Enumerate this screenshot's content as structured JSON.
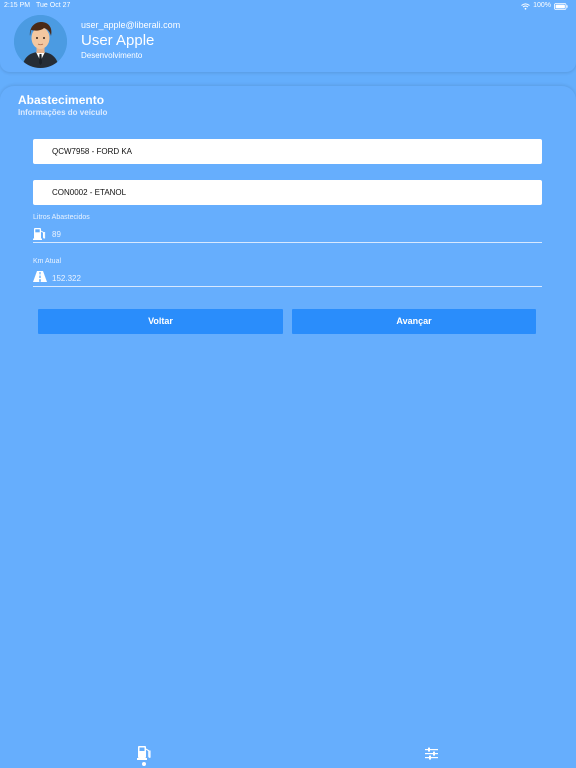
{
  "status_bar": {
    "time": "2:15 PM",
    "date": "Tue Oct 27",
    "battery": "100%"
  },
  "user": {
    "email": "user_apple@liberali.com",
    "name": "User Apple",
    "department": "Desenvolvimento"
  },
  "page": {
    "title": "Abastecimento",
    "subtitle": "Informações do veículo"
  },
  "form": {
    "vehicle": "QCW7958 - FORD KA",
    "fuel": "CON0002 - ETANOL",
    "liters_label": "Litros Abastecidos",
    "liters_value": "89",
    "km_label": "Km Atual",
    "km_value": "152.322"
  },
  "buttons": {
    "back": "Voltar",
    "next": "Avançar"
  },
  "tabs": [
    {
      "icon": "fuel-pump-icon",
      "active": true
    },
    {
      "icon": "sliders-icon",
      "active": false
    }
  ],
  "colors": {
    "background": "#64aefc",
    "button": "#2a8dfb",
    "text": "#ffffff"
  }
}
